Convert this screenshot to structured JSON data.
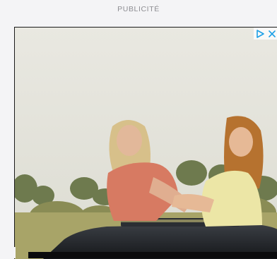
{
  "ad": {
    "label": "PUBLICITÉ",
    "choices_icons": [
      "adchoices-play-icon",
      "close-icon"
    ],
    "colors": {
      "adchoices": "#1ea0e6",
      "frame": "#1a1a1a",
      "label": "#8d8d92"
    }
  }
}
